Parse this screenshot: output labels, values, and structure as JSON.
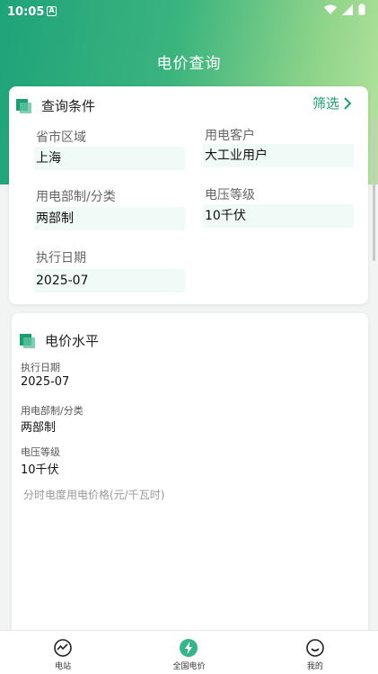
{
  "status": {
    "time": "10:05",
    "notif_glyph": "A"
  },
  "header": {
    "title": "电价查询"
  },
  "conditions": {
    "title": "查询条件",
    "filter_label": "筛选",
    "region_label": "省市区域",
    "region_value": "上海",
    "customer_label": "用电客户",
    "customer_value": "大工业用户",
    "category_label": "用电部制/分类",
    "category_value": "两部制",
    "voltage_label": "电压等级",
    "voltage_value": "10千伏",
    "date_label": "执行日期",
    "date_value": "2025-07"
  },
  "level": {
    "title": "电价水平",
    "date_label": "执行日期",
    "date_value": "2025-07",
    "category_label": "用电部制/分类",
    "category_value": "两部制",
    "voltage_label": "电压等级",
    "voltage_value": "10千伏",
    "tou_label": "分时电度用电价格(元/千瓦时)"
  },
  "nav": {
    "items": [
      {
        "label": "电站",
        "icon": "chart-line-icon"
      },
      {
        "label": "全国电价",
        "icon": "lightning-icon"
      },
      {
        "label": "我的",
        "icon": "smile-icon"
      }
    ]
  },
  "colors": {
    "accent": "#1b9e73",
    "header_start": "#1fa37a",
    "header_end": "#b5e39c"
  }
}
